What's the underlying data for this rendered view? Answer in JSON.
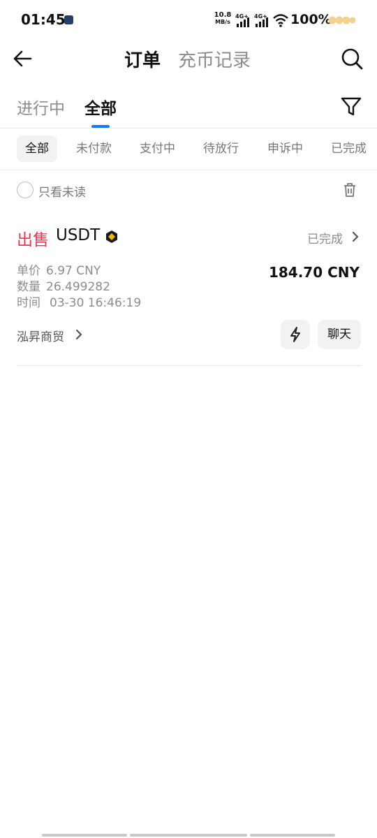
{
  "status_bar": {
    "time": "01:45",
    "net_speed_value": "10.8",
    "net_speed_unit": "MB/s",
    "signal1": "4G+",
    "signal2": "4G+",
    "battery": "100%"
  },
  "header": {
    "title_main": "订单",
    "title_secondary": "充币记录"
  },
  "tabs": [
    {
      "label": "进行中",
      "active": false
    },
    {
      "label": "全部",
      "active": true
    }
  ],
  "status_filters": [
    {
      "label": "全部",
      "active": true
    },
    {
      "label": "未付款",
      "active": false
    },
    {
      "label": "支付中",
      "active": false
    },
    {
      "label": "待放行",
      "active": false
    },
    {
      "label": "申诉中",
      "active": false
    },
    {
      "label": "已完成",
      "active": false
    }
  ],
  "unread_filter": {
    "label": "只看未读",
    "checked": false
  },
  "order": {
    "side": "出售",
    "coin": "USDT",
    "status": "已完成",
    "price_label": "单价",
    "price_value": "6.97 CNY",
    "quantity_label": "数量",
    "quantity_value": "26.499282",
    "time_label": "时间",
    "time_value": "03-30 16:46:19",
    "total": "184.70 CNY",
    "merchant": "泓昇商贸",
    "chat_label": "聊天"
  },
  "colors": {
    "sell": "#e1384e",
    "accent": "#1677ff",
    "muted": "#8c8c8c"
  },
  "icons": [
    "back-arrow-icon",
    "search-icon",
    "filter-icon",
    "trash-icon",
    "coin-badge-icon",
    "chevron-right-icon",
    "lightning-icon"
  ]
}
